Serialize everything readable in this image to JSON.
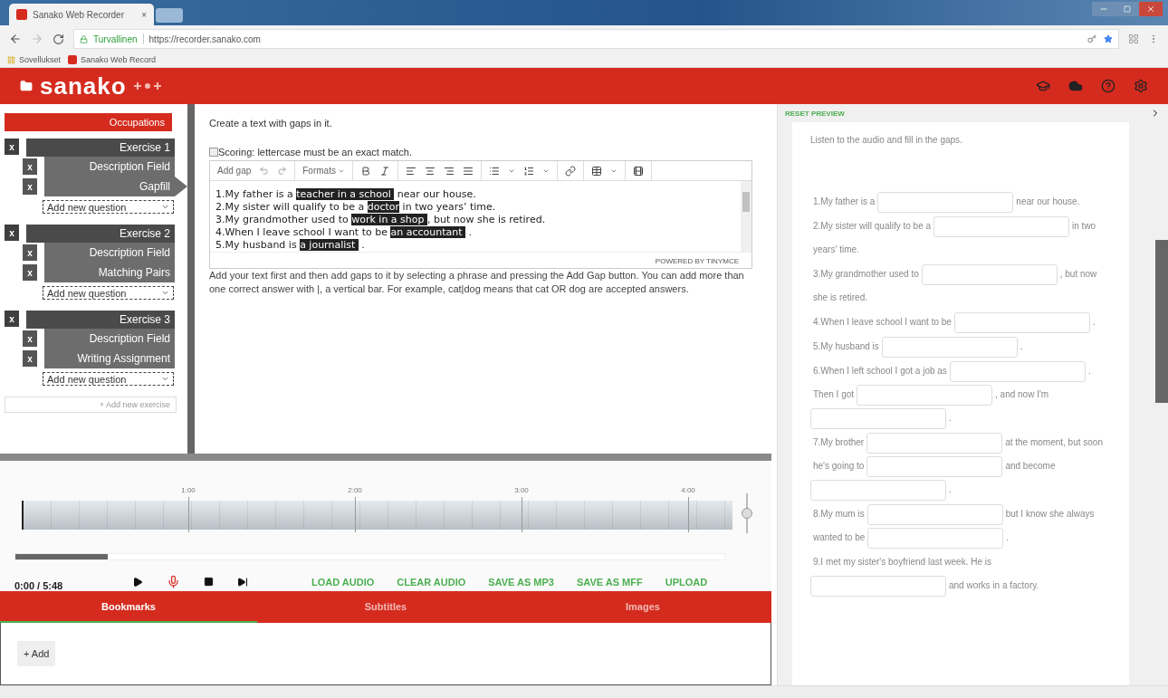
{
  "browser": {
    "tabs": [
      {
        "title": "Sanako Web Recorder",
        "close": "×",
        "selected": true
      }
    ],
    "security": "Turvallinen",
    "url": "https://recorder.sanako.com",
    "bookmarks": [
      "Sovellukset",
      "Sanako Web Record"
    ]
  },
  "app": {
    "logo": "sanako"
  },
  "sidebar": {
    "title": "Occupations",
    "exercises": [
      {
        "title": "Exercise 1",
        "close": "x",
        "add_question": "Add new question",
        "questions": [
          {
            "title": "Description Field",
            "close": "x",
            "selected": false
          },
          {
            "title": "Gapfill",
            "close": "x",
            "selected": true
          }
        ]
      },
      {
        "title": "Exercise 2",
        "close": "x",
        "add_question": "Add new question",
        "questions": [
          {
            "title": "Description Field",
            "close": "x",
            "selected": false
          },
          {
            "title": "Matching Pairs",
            "close": "x",
            "selected": false
          }
        ]
      },
      {
        "title": "Exercise 3",
        "close": "x",
        "add_question": "Add new question",
        "questions": [
          {
            "title": "Description Field",
            "close": "x",
            "selected": false
          },
          {
            "title": "Writing Assignment",
            "close": "x",
            "selected": false
          }
        ]
      }
    ],
    "add_exercise": "+ Add new exercise"
  },
  "editor": {
    "instruction": "Create a text with gaps in it.",
    "scoring": {
      "label": "Scoring: lettercase must be an exact match.",
      "checked": false
    },
    "toolbar": {
      "add_gap": "Add gap",
      "formats": "Formats"
    },
    "lines": [
      [
        {
          "kind": "text",
          "text": "1.My father is a "
        },
        {
          "kind": "gap",
          "text": "teacher in a school "
        },
        {
          "kind": "text",
          "text": " near our house."
        }
      ],
      [
        {
          "kind": "text",
          "text": "2.My sister will qualify to be a "
        },
        {
          "kind": "gap",
          "text": "doctor"
        },
        {
          "kind": "text",
          "text": " in two years’ time."
        }
      ],
      [
        {
          "kind": "text",
          "text": "3.My grandmother used to "
        },
        {
          "kind": "gap",
          "text": "work in a shop "
        },
        {
          "kind": "text",
          "text": ", but now she is retired."
        }
      ],
      [
        {
          "kind": "text",
          "text": "4.When I leave school I want to be "
        },
        {
          "kind": "gap",
          "text": "an accountant "
        },
        {
          "kind": "text",
          "text": " ."
        }
      ],
      [
        {
          "kind": "text",
          "text": "5.My husband is "
        },
        {
          "kind": "gap",
          "text": "a journalist "
        },
        {
          "kind": "text",
          "text": " ."
        }
      ]
    ],
    "powered_by": "POWERED BY TINYMCE",
    "help": "Add your text first and then add gaps to it by selecting a phrase and pressing the Add Gap button. You can add more than one correct answer with |, a vertical bar. For example, cat|dog means that cat OR dog are accepted answers."
  },
  "audio": {
    "ticks": [
      "1:00",
      "2:00",
      "3:00",
      "4:00"
    ],
    "progress": {
      "level": 0.13
    },
    "volume": {
      "level": 0.5
    },
    "time": "0:00 / 5:48",
    "actions": [
      "LOAD AUDIO",
      "CLEAR AUDIO",
      "SAVE AS MP3",
      "SAVE AS MFF",
      "UPLOAD"
    ]
  },
  "panel_tabs": [
    {
      "label": "Bookmarks",
      "selected": true
    },
    {
      "label": "Subtitles",
      "selected": false
    },
    {
      "label": "Images",
      "selected": false
    }
  ],
  "bookmarks_panel": {
    "add": "+ Add"
  },
  "preview": {
    "reset": "RESET PREVIEW",
    "instruction": "Listen to the audio and fill in the gaps.",
    "paragraphs": [
      [
        {
          "kind": "text",
          "text": "1.My father is a"
        },
        {
          "kind": "gap"
        },
        {
          "kind": "text",
          "text": "near our house."
        }
      ],
      [
        {
          "kind": "text",
          "text": "2.My sister will qualify to be a"
        },
        {
          "kind": "gap"
        },
        {
          "kind": "text",
          "text": "in two"
        },
        {
          "kind": "text",
          "text": "years' time."
        }
      ],
      [
        {
          "kind": "text",
          "text": "3.My grandmother used to"
        },
        {
          "kind": "gap"
        },
        {
          "kind": "text",
          "text": ", but now"
        },
        {
          "kind": "text",
          "text": "she is retired."
        }
      ],
      [
        {
          "kind": "text",
          "text": "4.When I leave school I want to be"
        },
        {
          "kind": "gap"
        },
        {
          "kind": "text",
          "text": "."
        }
      ],
      [
        {
          "kind": "text",
          "text": "5.My husband is"
        },
        {
          "kind": "gap"
        },
        {
          "kind": "text",
          "text": "."
        }
      ],
      [
        {
          "kind": "text",
          "text": "6.When I left school I got a job as"
        },
        {
          "kind": "gap"
        },
        {
          "kind": "text",
          "text": "."
        },
        {
          "kind": "text",
          "text": "Then I got"
        },
        {
          "kind": "gap"
        },
        {
          "kind": "text",
          "text": ", and now I'm"
        },
        {
          "kind": "gap"
        },
        {
          "kind": "text",
          "text": "."
        }
      ],
      [
        {
          "kind": "text",
          "text": "7.My brother"
        },
        {
          "kind": "gap"
        },
        {
          "kind": "text",
          "text": "at the moment, but soon"
        },
        {
          "kind": "text",
          "text": "he's going to"
        },
        {
          "kind": "gap"
        },
        {
          "kind": "text",
          "text": "and become"
        },
        {
          "kind": "gap"
        },
        {
          "kind": "text",
          "text": "."
        }
      ],
      [
        {
          "kind": "text",
          "text": "8.My mum is"
        },
        {
          "kind": "gap"
        },
        {
          "kind": "text",
          "text": "but I know she always"
        },
        {
          "kind": "text",
          "text": "wanted to be"
        },
        {
          "kind": "gap"
        },
        {
          "kind": "text",
          "text": "."
        }
      ],
      [
        {
          "kind": "text",
          "text": "9.I met my sister's boyfriend last week. He is"
        },
        {
          "kind": "gap"
        },
        {
          "kind": "text",
          "text": "and works in a factory."
        }
      ]
    ]
  }
}
